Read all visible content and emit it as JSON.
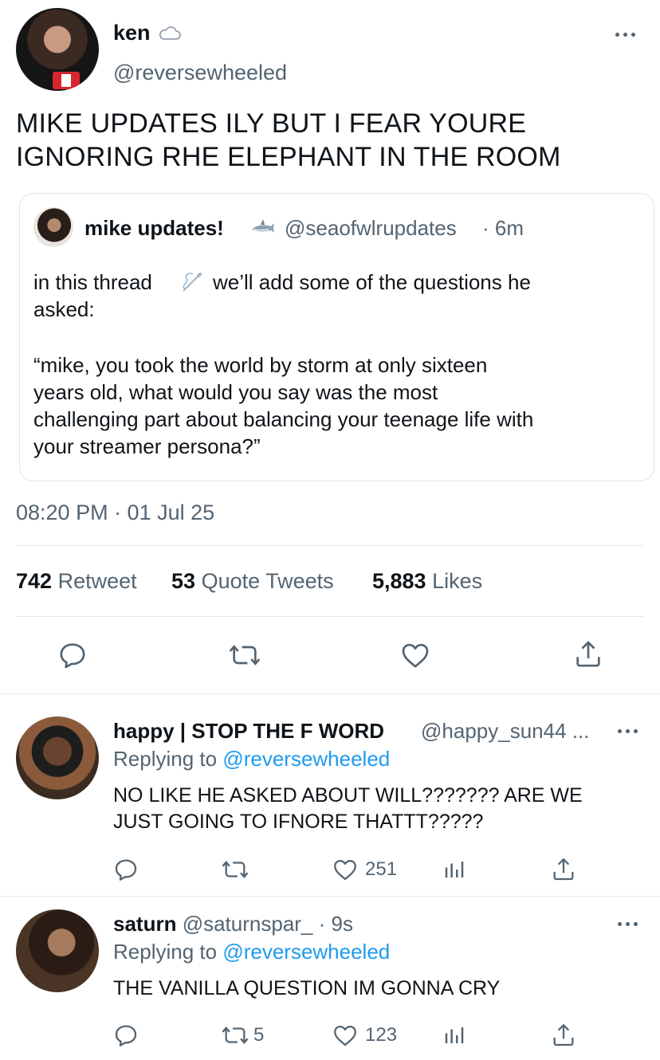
{
  "tweet": {
    "display_name": "ken",
    "handle": "@reversewheeled",
    "text_line1": "MIKE UPDATES ILY BUT I FEAR YOURE",
    "text_line2": "IGNORING RHE ELEPHANT IN THE ROOM",
    "timestamp": "08:20 PM · 01 Jul 25",
    "stats": {
      "retweets_count": "742",
      "retweets_label": "Retweet",
      "quotes_count": "53",
      "quotes_label": "Quote Tweets",
      "likes_count": "5,883",
      "likes_label": "Likes"
    }
  },
  "quoted": {
    "display_name": "mike updates!",
    "handle": "@seaofwlrupdates",
    "time": "· 6m",
    "line1a": "in this thread",
    "line1b": "we’ll add some of the questions he",
    "line2": "asked:",
    "line3": "“mike, you took the world by storm at only sixteen",
    "line4": "years old, what would you say was the most",
    "line5": "challenging part about balancing your teenage life with",
    "line6": "your streamer persona?”"
  },
  "replies": [
    {
      "display_name": "happy | STOP THE F WORD",
      "handle": "@happy_sun44 ...",
      "replying_prefix": "Replying to",
      "replying_handle": "@reversewheeled",
      "text_line1": "NO LIKE HE ASKED ABOUT WILL??????? ARE WE",
      "text_line2": "JUST GOING TO IFNORE THATTT?????",
      "retweets": "",
      "likes": "251"
    },
    {
      "display_name": "saturn",
      "handle": "@saturnspar_",
      "time": "· 9s",
      "replying_prefix": "Replying to",
      "replying_handle": "@reversewheeled",
      "text_line1": "THE VANILLA QUESTION IM GONNA CRY",
      "retweets": "5",
      "likes": "123"
    }
  ],
  "icons": [
    "cloud-icon",
    "more-icon",
    "shark-icon",
    "thread-needle-icon",
    "reply-icon",
    "retweet-icon",
    "like-icon",
    "share-icon",
    "analytics-icon"
  ],
  "colors": {
    "accent": "#1d9bf0",
    "muted": "#536471",
    "text": "#0f1419",
    "divider": "#e3e7ea"
  }
}
